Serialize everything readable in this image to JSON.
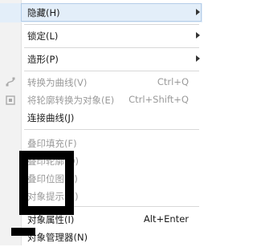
{
  "menu": {
    "items": [
      {
        "label": "隐藏(H)",
        "shortcut": "",
        "disabled": false,
        "submenu": true
      },
      {
        "label": "锁定(L)",
        "shortcut": "",
        "disabled": false,
        "submenu": true
      },
      {
        "label": "造形(P)",
        "shortcut": "",
        "disabled": false,
        "submenu": true
      },
      {
        "label": "转换为曲线(V)",
        "shortcut": "Ctrl+Q",
        "disabled": true,
        "submenu": false
      },
      {
        "label": "将轮廓转换为对象(E)",
        "shortcut": "Ctrl+Shift+Q",
        "disabled": true,
        "submenu": false
      },
      {
        "label": "连接曲线(J)",
        "shortcut": "",
        "disabled": false,
        "submenu": false
      },
      {
        "label": "叠印填充(F)",
        "shortcut": "",
        "disabled": true,
        "submenu": false
      },
      {
        "label": "叠印轮廓(O)",
        "shortcut": "",
        "disabled": true,
        "submenu": false
      },
      {
        "label": "叠印位图(V)",
        "shortcut": "",
        "disabled": true,
        "submenu": false
      },
      {
        "label": "对象提示(H)",
        "shortcut": "",
        "disabled": true,
        "submenu": false
      },
      {
        "label": "对象属性(I)",
        "shortcut": "Alt+Enter",
        "disabled": false,
        "submenu": false
      },
      {
        "label": "对象管理器(N)",
        "shortcut": "",
        "disabled": false,
        "submenu": false
      }
    ]
  },
  "icons": {
    "convert": "convert-to-curves-icon",
    "outline": "outline-to-object-icon"
  }
}
